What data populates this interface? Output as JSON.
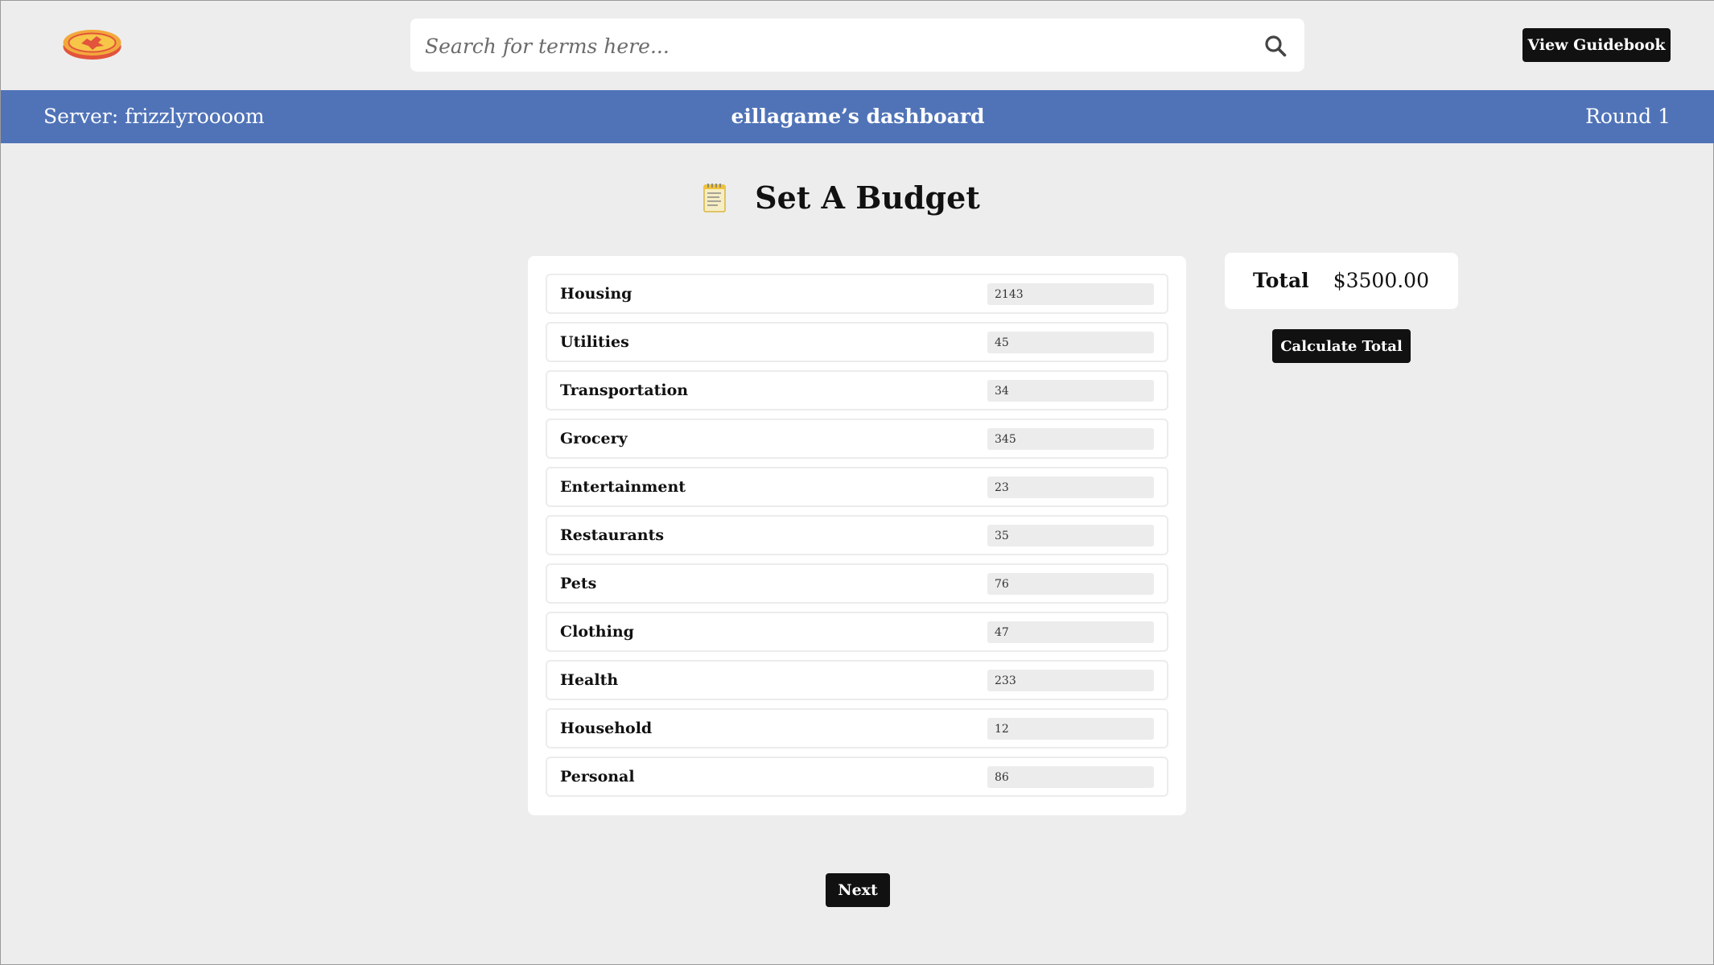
{
  "header": {
    "search_placeholder": "Search for terms here...",
    "guidebook_label": "View Guidebook"
  },
  "status_bar": {
    "server": "Server: frizzlyroooom",
    "dashboard": "eillagame’s dashboard",
    "round": "Round 1",
    "color": "#5073b8"
  },
  "page": {
    "title": "Set A Budget",
    "title_icon": "notepad-icon"
  },
  "budget": {
    "items": [
      {
        "label": "Housing",
        "value": "2143"
      },
      {
        "label": "Utilities",
        "value": "45"
      },
      {
        "label": "Transportation",
        "value": "34"
      },
      {
        "label": "Grocery",
        "value": "345"
      },
      {
        "label": "Entertainment",
        "value": "23"
      },
      {
        "label": "Restaurants",
        "value": "35"
      },
      {
        "label": "Pets",
        "value": "76"
      },
      {
        "label": "Clothing",
        "value": "47"
      },
      {
        "label": "Health",
        "value": "233"
      },
      {
        "label": "Household",
        "value": "12"
      },
      {
        "label": "Personal",
        "value": "86"
      }
    ]
  },
  "total": {
    "label": "Total",
    "value": "$3500.00",
    "calculate_label": "Calculate Total"
  },
  "footer": {
    "next_label": "Next"
  }
}
